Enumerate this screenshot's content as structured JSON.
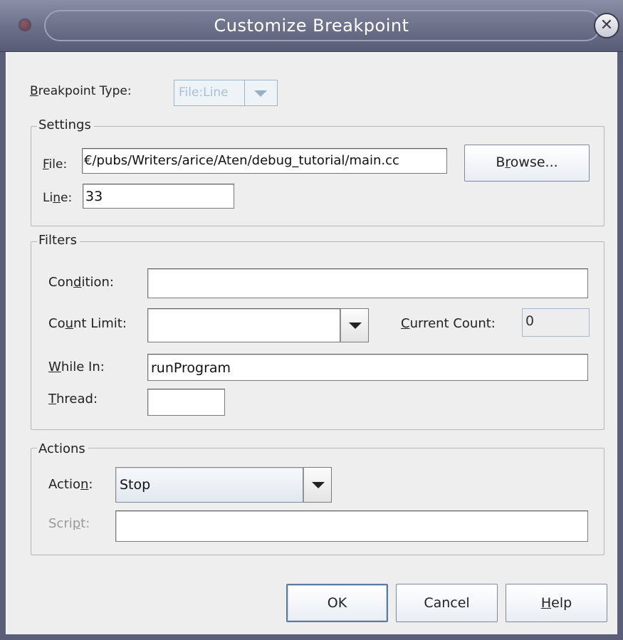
{
  "window": {
    "title": "Customize Breakpoint",
    "close_icon": "close-icon",
    "menu_icon": "window-menu-icon"
  },
  "breakpoint_type": {
    "label_mnemonic": "B",
    "label_rest": "reakpoint Type:",
    "value": "File:Line"
  },
  "settings": {
    "title": "Settings",
    "file_label_mnemonic": "F",
    "file_label_rest": "ile:",
    "file_value": "€/pubs/Writers/arice/Aten/debug_tutorial/main.cc",
    "browse_pre": "B",
    "browse_mnemonic": "r",
    "browse_post": "owse...",
    "line_label_pre": "Li",
    "line_label_mnemonic": "n",
    "line_label_post": "e:",
    "line_value": "33"
  },
  "filters": {
    "title": "Filters",
    "condition_pre": "Con",
    "condition_mnemonic": "d",
    "condition_post": "ition:",
    "condition_value": "",
    "count_limit_pre": "Co",
    "count_limit_mnemonic": "u",
    "count_limit_post": "nt Limit:",
    "count_limit_value": "",
    "current_count_mnemonic": "C",
    "current_count_rest": "urrent Count:",
    "current_count_value": "0",
    "while_in_mnemonic": "W",
    "while_in_rest": "hile In:",
    "while_in_value": "runProgram",
    "thread_mnemonic": "T",
    "thread_rest": "hread:",
    "thread_value": ""
  },
  "actions": {
    "title": "Actions",
    "action_pre": "Actio",
    "action_mnemonic": "n",
    "action_post": ":",
    "action_value": "Stop",
    "script_pre": "Scri",
    "script_mnemonic": "p",
    "script_post": "t:",
    "script_value": ""
  },
  "buttons": {
    "ok": "OK",
    "cancel": "Cancel",
    "help_mnemonic": "H",
    "help_rest": "elp"
  }
}
